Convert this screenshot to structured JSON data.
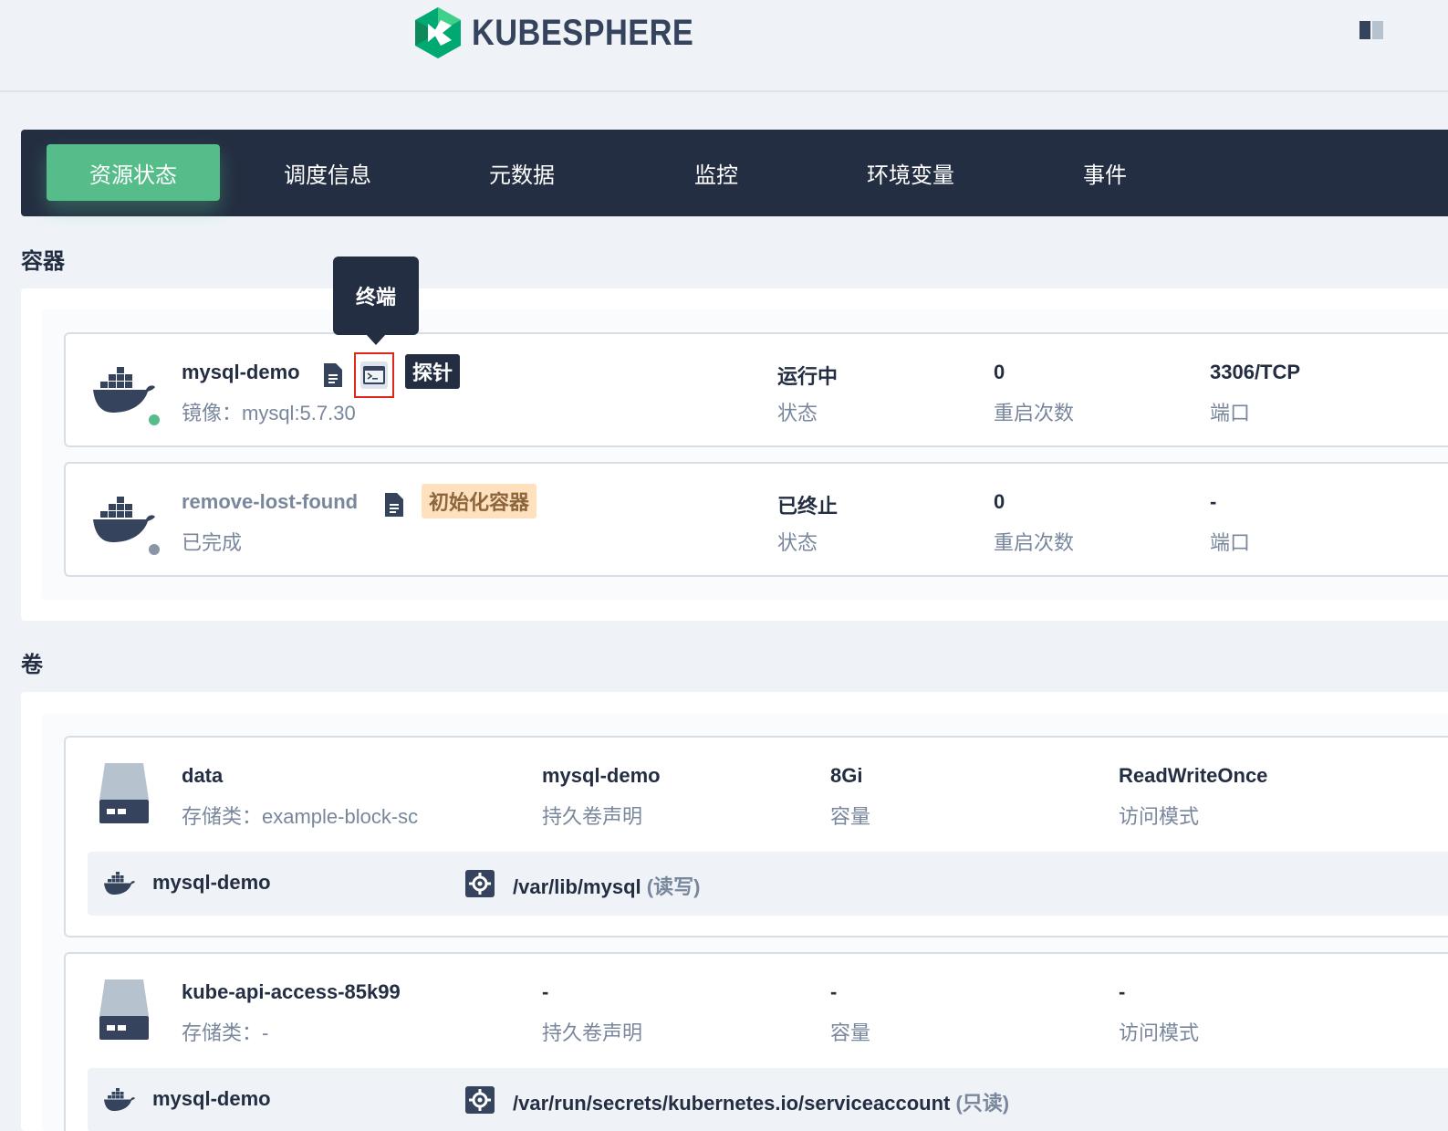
{
  "header": {
    "logo_text": "KUBESPHERE",
    "logo_icon": "kubesphere-logo-icon",
    "right_icon": "book-icon"
  },
  "tabs": [
    {
      "label": "资源状态",
      "active": true
    },
    {
      "label": "调度信息",
      "active": false
    },
    {
      "label": "元数据",
      "active": false
    },
    {
      "label": "监控",
      "active": false
    },
    {
      "label": "环境变量",
      "active": false
    },
    {
      "label": "事件",
      "active": false
    }
  ],
  "containers": {
    "title": "容器",
    "tooltip": "终端",
    "items": [
      {
        "name": "mysql-demo",
        "sub": "镜像：mysql:5.7.30",
        "tag": "探针",
        "status_value": "运行中",
        "status_label": "状态",
        "restarts_value": "0",
        "restarts_label": "重启次数",
        "ports_value": "3306/TCP",
        "ports_label": "端口",
        "state_color": "#55bc8a"
      },
      {
        "name": "remove-lost-found",
        "sub": "已完成",
        "tag": "初始化容器",
        "status_value": "已终止",
        "status_label": "状态",
        "restarts_value": "0",
        "restarts_label": "重启次数",
        "ports_value": "-",
        "ports_label": "端口",
        "state_color": "#8a96a8"
      }
    ]
  },
  "volumes": {
    "title": "卷",
    "items": [
      {
        "name": "data",
        "sub": "存储类：example-block-sc",
        "pvc_value": "mysql-demo",
        "pvc_label": "持久卷声明",
        "capacity_value": "8Gi",
        "capacity_label": "容量",
        "access_value": "ReadWriteOnce",
        "access_label": "访问模式",
        "mount": {
          "container": "mysql-demo",
          "path": "/var/lib/mysql",
          "mode": "(读写)"
        }
      },
      {
        "name": "kube-api-access-85k99",
        "sub": "存储类：-",
        "pvc_value": "-",
        "pvc_label": "持久卷声明",
        "capacity_value": "-",
        "capacity_label": "容量",
        "access_value": "-",
        "access_label": "访问模式",
        "mount": {
          "container": "mysql-demo",
          "path": "/var/run/secrets/kubernetes.io/serviceaccount",
          "mode": "(只读)"
        }
      }
    ]
  },
  "colors": {
    "accent": "#55bc8a",
    "dark": "#242e42",
    "muted": "#79879c",
    "orange_tag_bg": "#ffe1be",
    "highlight_border": "#e1261c"
  }
}
